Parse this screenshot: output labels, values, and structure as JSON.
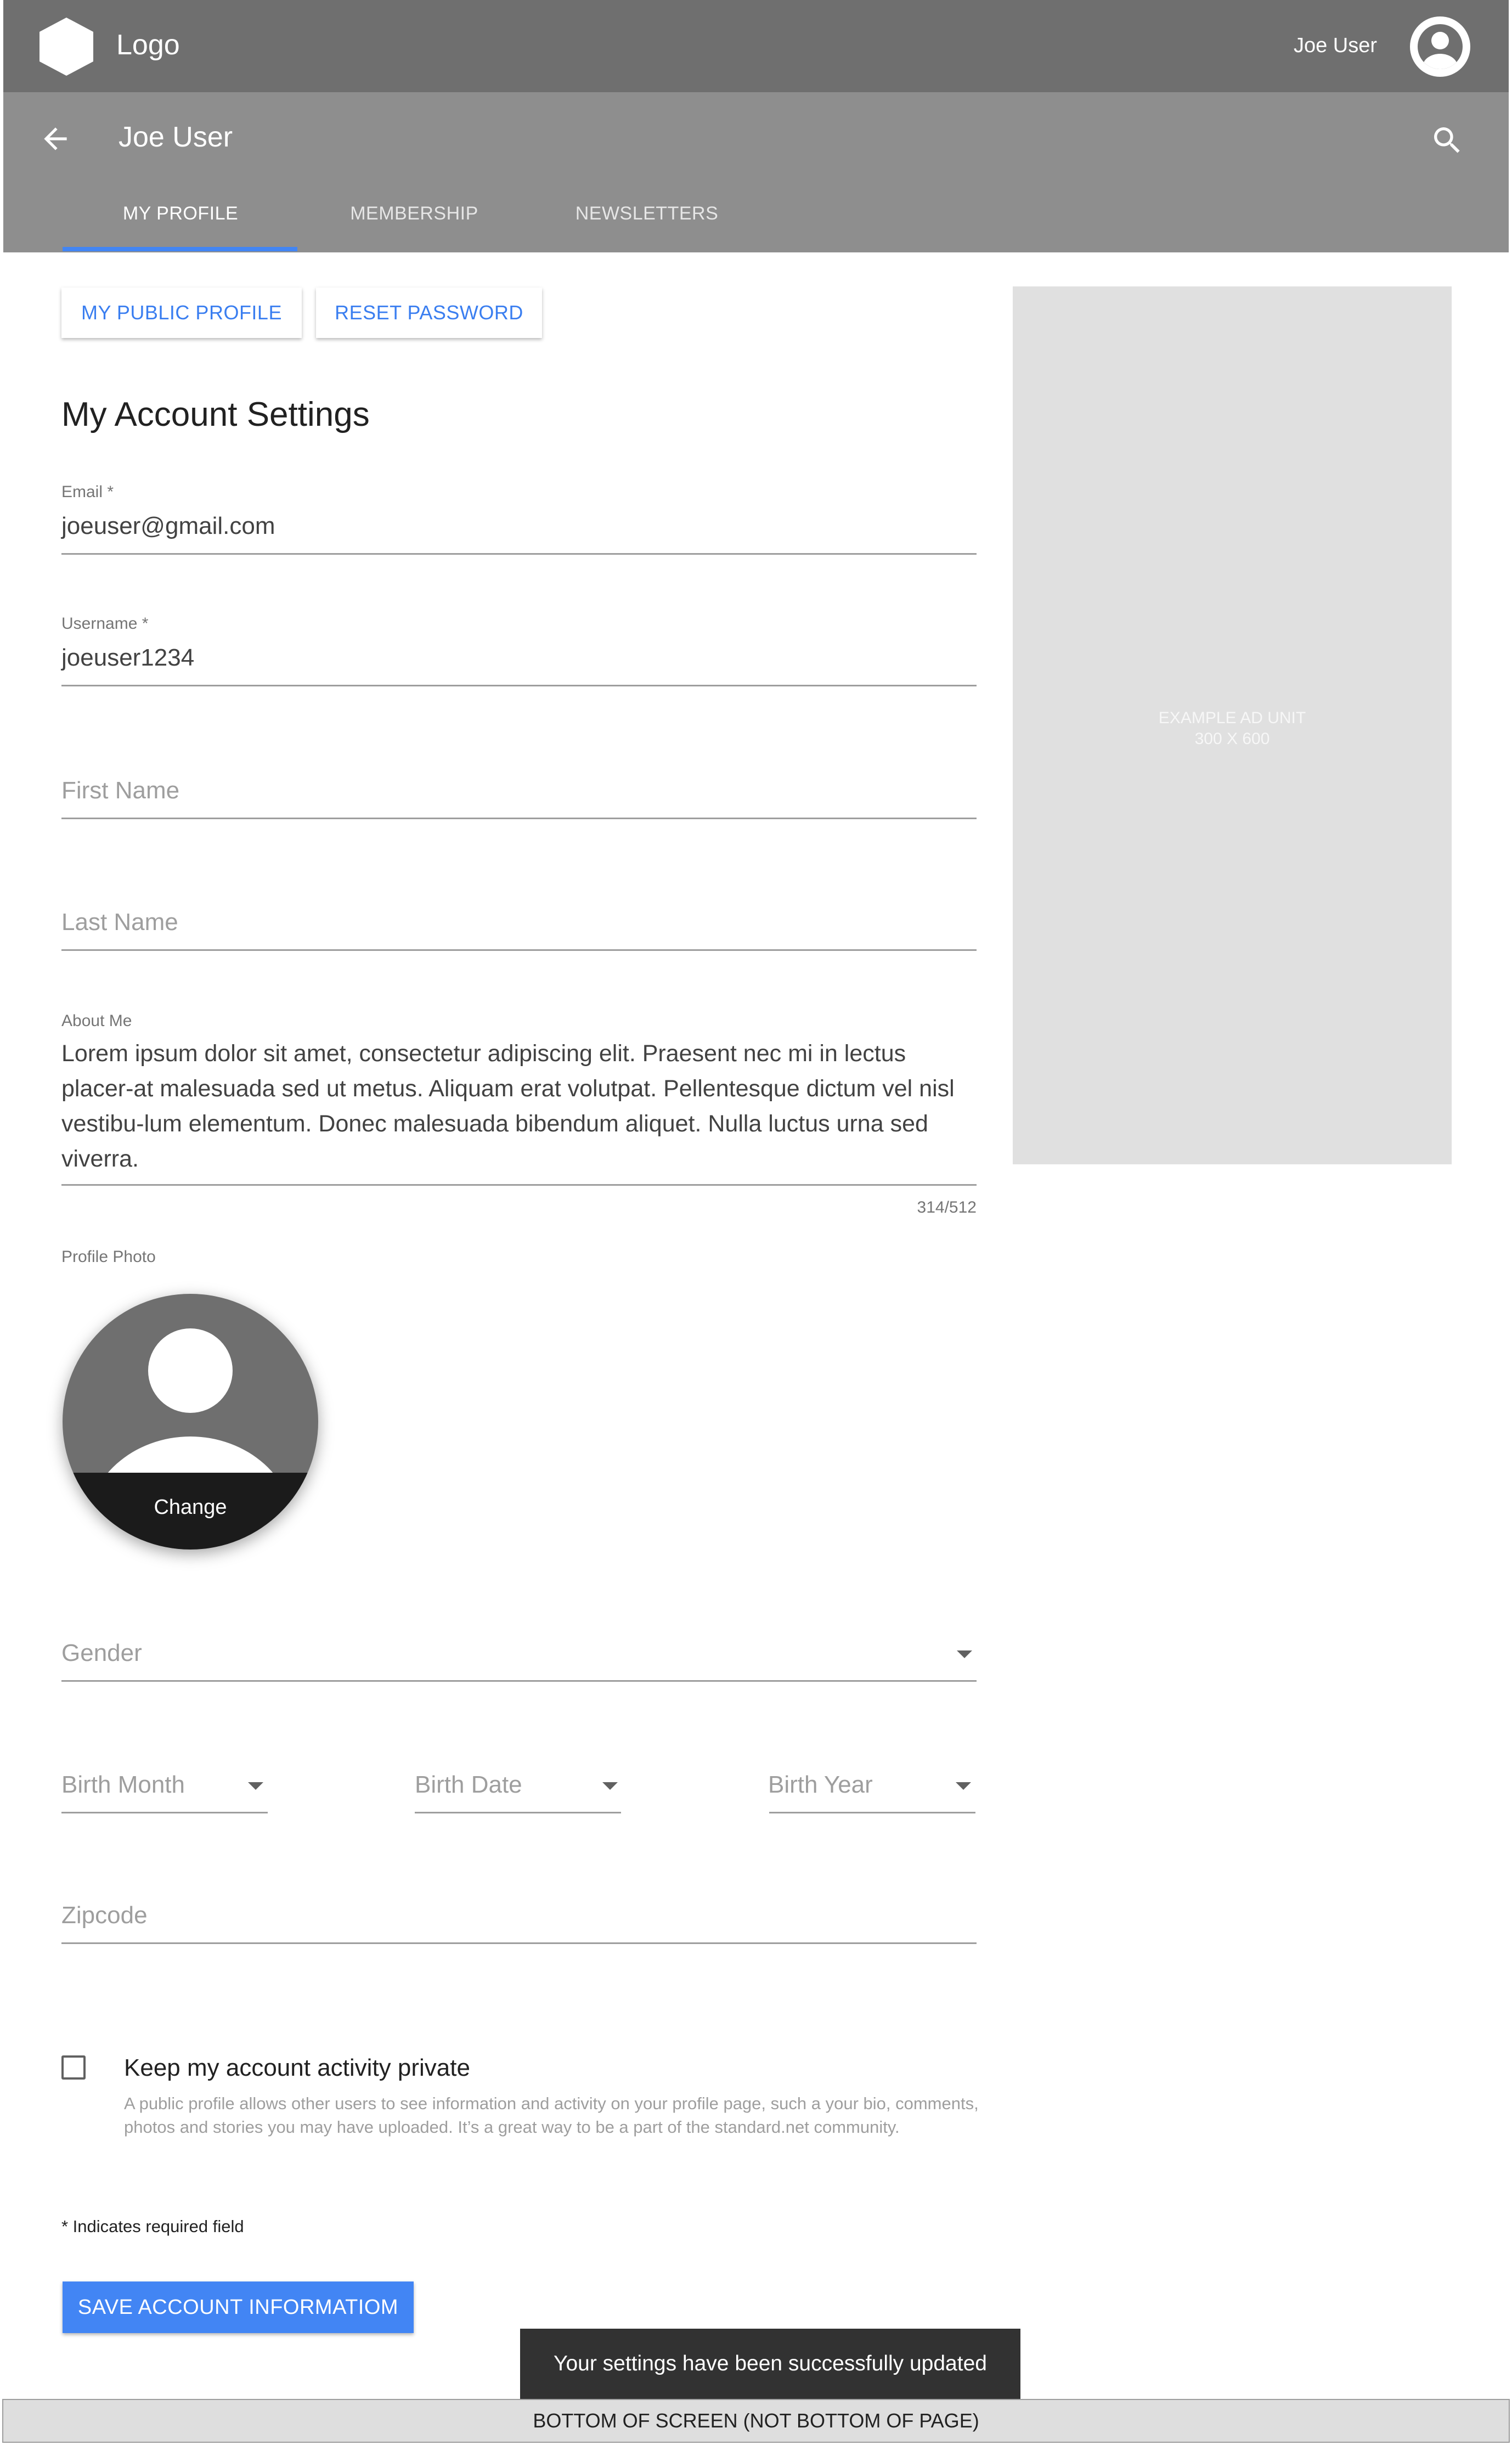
{
  "topbar": {
    "logo_label": "Logo",
    "user_name": "Joe User"
  },
  "subbar": {
    "title": "Joe User"
  },
  "tabs": [
    {
      "label": "MY PROFILE"
    },
    {
      "label": "MEMBERSHIP"
    },
    {
      "label": "NEWSLETTERS"
    }
  ],
  "actions": {
    "public_profile": "MY PUBLIC PROFILE",
    "reset_password": "RESET PASSWORD"
  },
  "heading": "My Account Settings",
  "fields": {
    "email": {
      "label": "Email *",
      "value": "joeuser@gmail.com"
    },
    "username": {
      "label": "Username *",
      "value": "joeuser1234"
    },
    "first_name": {
      "placeholder": "First Name"
    },
    "last_name": {
      "placeholder": "Last Name"
    },
    "about": {
      "label": "About Me",
      "value": "Lorem ipsum dolor sit amet, consectetur adipiscing elit. Praesent nec mi in lectus placer-at malesuada sed ut metus. Aliquam erat volutpat. Pellentesque dictum vel nisl vestibu-lum elementum. Donec malesuada bibendum aliquet. Nulla luctus urna sed viverra.",
      "count": "314/512"
    },
    "photo": {
      "label": "Profile Photo",
      "change": "Change"
    },
    "gender": {
      "placeholder": "Gender"
    },
    "birth_month": {
      "placeholder": "Birth Month"
    },
    "birth_date": {
      "placeholder": "Birth Date"
    },
    "birth_year": {
      "placeholder": "Birth Year"
    },
    "zipcode": {
      "placeholder": "Zipcode"
    }
  },
  "privacy": {
    "label": "Keep my account activity private",
    "help": "A public profile allows other users to see information and activity on your profile page, such a your bio, comments, photos and stories you may have uploaded. It’s a great way to be a part of the standard.net community.",
    "checked": false
  },
  "required_note": "* Indicates required field",
  "save_label": "SAVE ACCOUNT INFORMATIOM",
  "snackbar": "Your  settings have been successfully updated",
  "bottom_marker": "BOTTOM OF SCREEN (NOT BOTTOM OF PAGE)",
  "ad": {
    "line1": "EXAMPLE AD UNIT",
    "line2": "300 X 600"
  },
  "icons": {
    "logo": "hexagon-logo-icon",
    "avatar": "account-circle-icon",
    "back": "arrow-back-icon",
    "search": "search-icon",
    "dropdown": "arrow-drop-down-icon"
  },
  "colors": {
    "accent": "#4285f4",
    "topbar": "#6f6f6f",
    "subbar": "#8e8e8e",
    "snackbar": "#323232"
  }
}
